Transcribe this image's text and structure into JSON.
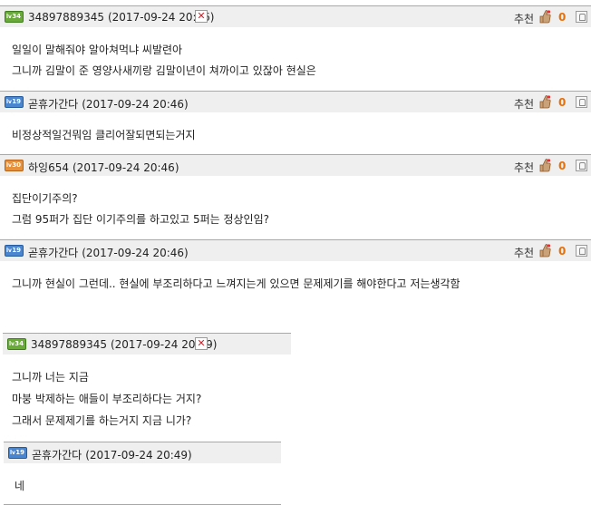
{
  "comments": [
    {
      "level_badge": "34",
      "author": "34897889345",
      "timestamp": "(2017-09-24 20:46)",
      "delete_icon": "✕",
      "recommend_label": "추천",
      "recommend_count": "0",
      "lines": [
        "일일이 말해줘야 알아쳐먹냐 씨발련아",
        "그니까 김말이 준 영양사새끼랑 김말이년이 쳐까이고 있잖아 현실은"
      ]
    },
    {
      "level_badge": "19",
      "author": "곧휴가간다",
      "timestamp": "(2017-09-24 20:46)",
      "recommend_label": "추천",
      "recommend_count": "0",
      "lines": [
        "비정상적일건뭐임 클리어잘되면되는거지"
      ]
    },
    {
      "level_badge": "30",
      "author": "하잉654",
      "timestamp": "(2017-09-24 20:46)",
      "recommend_label": "추천",
      "recommend_count": "0",
      "lines": [
        "집단이기주의?",
        "그럼 95퍼가 집단 이기주의를 하고있고 5퍼는 정상인임?"
      ]
    },
    {
      "level_badge": "19",
      "author": "곧휴가간다",
      "timestamp": "(2017-09-24 20:46)",
      "recommend_label": "추천",
      "recommend_count": "0",
      "lines": [
        "그니까 현실이 그런데.. 현실에 부조리하다고 느껴지는게 있으면 문제제기를 해야한다고 저는생각함"
      ]
    },
    {
      "level_badge": "34",
      "author": "34897889345",
      "timestamp": "(2017-09-24 20:49)",
      "delete_icon": "✕",
      "lines": [
        "그니까 너는 지금",
        "마붕 박제하는 애들이 부조리하다는 거지?",
        "그래서 문제제기를 하는거지 지금 니가?"
      ]
    },
    {
      "level_badge": "19",
      "author": "곧휴가간다",
      "timestamp": "(2017-09-24 20:49)",
      "lines": [
        "네"
      ]
    }
  ],
  "icons": {
    "level_badge": "level-badge-icon",
    "delete": "delete-icon",
    "recommend": "thumbs-up-icon",
    "report": "report-icon"
  },
  "colors": {
    "header_bg": "#efefef",
    "separator": "#a9a9a9",
    "recommend_count": "#e6700a",
    "delete": "#d0202a",
    "badge_green": "#6aaa3a",
    "badge_blue": "#4a86d0",
    "badge_orange": "#e6913c"
  }
}
